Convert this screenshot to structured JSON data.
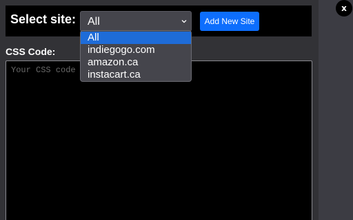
{
  "site_bar": {
    "label": "Select site:",
    "selected_value": "All",
    "add_button_label": "Add New Site"
  },
  "dropdown": {
    "options": [
      "All",
      "indiegogo.com",
      "amazon.ca",
      "instacart.ca"
    ],
    "highlighted_option": "All"
  },
  "css_section": {
    "label": "CSS Code:",
    "placeholder": "Your CSS code here",
    "value": ""
  },
  "close_button": {
    "label": "x"
  },
  "colors": {
    "accent": "#0d6efd",
    "highlight": "#1e6cd8",
    "panel_bg": "#323236",
    "outer_bg": "#3c3c43",
    "bar_bg": "#000000"
  },
  "icons": {
    "select_arrow": "chevron-down-icon"
  }
}
